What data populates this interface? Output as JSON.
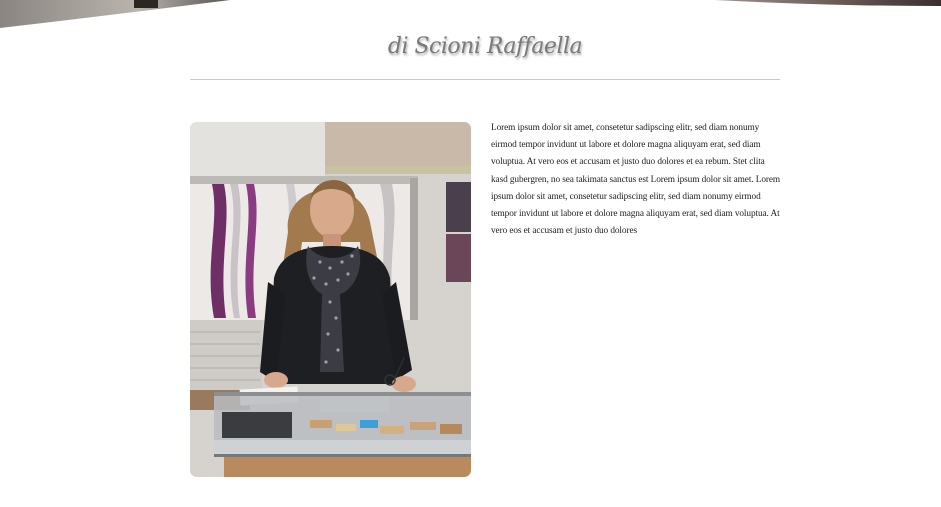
{
  "header": {
    "title": "di Scioni Raffaella"
  },
  "content": {
    "portrait_alt": "Raffaella Scioni",
    "paragraph": "Lorem ipsum dolor sit amet, consetetur sadipscing elitr, sed diam nonumy eirmod tempor invidunt ut labore et dolore magna aliquyam erat, sed diam voluptua. At vero eos et accusam et justo duo dolores et ea rebum. Stet clita kasd gubergren, no sea takimata sanctus est Lorem ipsum dolor sit amet. Lorem ipsum dolor sit amet, consetetur sadipscing elitr, sed diam nonumy eirmod tempor invidunt ut labore et dolore magna aliquyam erat, sed diam voluptua. At vero eos et accusam et justo duo dolores"
  },
  "colors": {
    "background": "#ffffff",
    "title": "#7a7a7a",
    "rule": "#c9c9c9",
    "text": "#222222"
  }
}
